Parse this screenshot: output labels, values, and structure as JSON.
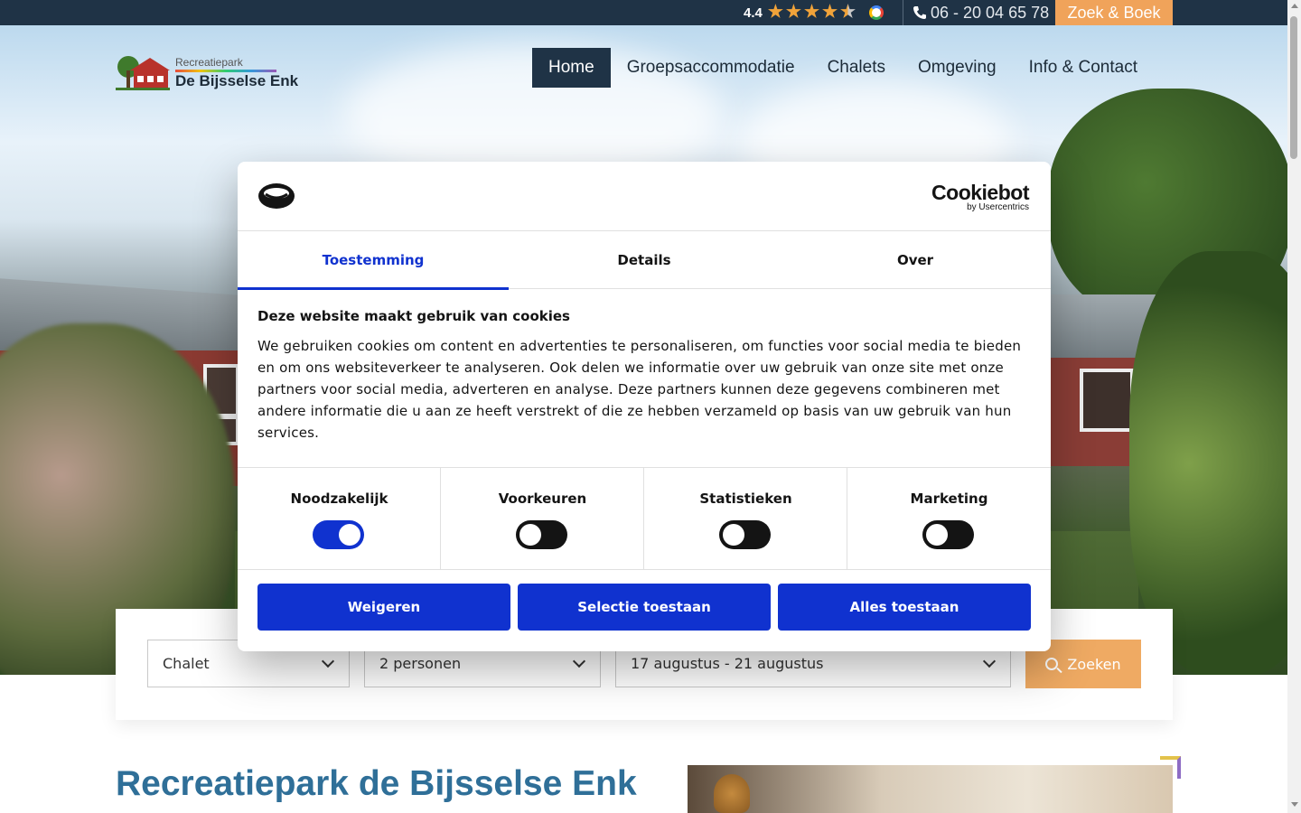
{
  "topbar": {
    "rating_value": "4.4",
    "rating_stars": 4.5,
    "phone": "06 - 20 04 65 78",
    "book_label": "Zoek & Boek",
    "accent_color": "#f0a35a",
    "bar_color": "#1f3346"
  },
  "logo": {
    "small_text": "Recreatiepark",
    "big_text": "De Bijsselse Enk"
  },
  "nav": {
    "items": [
      {
        "label": "Home",
        "active": true
      },
      {
        "label": "Groepsaccommodatie",
        "active": false
      },
      {
        "label": "Chalets",
        "active": false
      },
      {
        "label": "Omgeving",
        "active": false
      },
      {
        "label": "Info & Contact",
        "active": false
      }
    ]
  },
  "search": {
    "type_value": "Chalet",
    "persons_value": "2 personen",
    "dates_value": "17 augustus - 21 augustus",
    "button_label": "Zoeken"
  },
  "content": {
    "heading": "Recreatiepark de Bijsselse Enk"
  },
  "cookie": {
    "brand": "Cookiebot",
    "brand_sub": "by Usercentrics",
    "tabs": [
      "Toestemming",
      "Details",
      "Over"
    ],
    "active_tab": "Toestemming",
    "title": "Deze website maakt gebruik van cookies",
    "text": "We gebruiken cookies om content en advertenties te personaliseren, om functies voor social media te bieden en om ons websiteverkeer te analyseren. Ook delen we informatie over uw gebruik van onze site met onze partners voor social media, adverteren en analyse. Deze partners kunnen deze gegevens combineren met andere informatie die u aan ze heeft verstrekt of die ze hebben verzameld op basis van uw gebruik van hun services.",
    "toggles": [
      {
        "label": "Noodzakelijk",
        "on": true
      },
      {
        "label": "Voorkeuren",
        "on": false
      },
      {
        "label": "Statistieken",
        "on": false
      },
      {
        "label": "Marketing",
        "on": false
      }
    ],
    "buttons": [
      "Weigeren",
      "Selectie toestaan",
      "Alles toestaan"
    ],
    "primary_color": "#1032cf"
  }
}
